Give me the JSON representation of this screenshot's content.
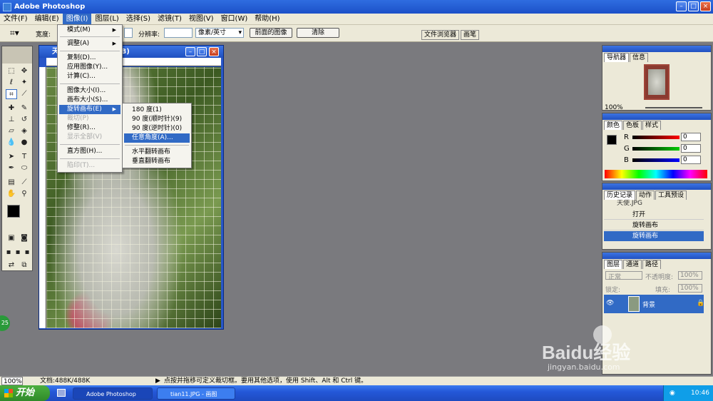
{
  "app": {
    "title": "Adobe Photoshop"
  },
  "menubar": [
    "文件(F)",
    "编辑(E)",
    "图像(I)",
    "图层(L)",
    "选择(S)",
    "滤镜(T)",
    "视图(V)",
    "窗口(W)",
    "帮助(H)"
  ],
  "options": {
    "width_label": "宽度:",
    "resolution_label": "分辨率:",
    "units_value": "像素/英寸",
    "front_image_button": "前面的图像",
    "clear_button": "清除",
    "file_browser_tab": "文件浏览器",
    "brushes_tab": "画笔"
  },
  "document": {
    "title_visible": "天",
    "title_suffix": "(B)"
  },
  "image_menu": {
    "items": [
      {
        "label": "模式(M)",
        "submenu": true
      },
      {
        "label": "调整(A)",
        "submenu": true
      },
      {
        "label": "复制(D)..."
      },
      {
        "label": "应用图像(Y)..."
      },
      {
        "label": "计算(C)..."
      },
      {
        "label": "图像大小(I)..."
      },
      {
        "label": "画布大小(S)..."
      },
      {
        "label": "旋转画布(E)",
        "submenu": true,
        "highlighted": true
      },
      {
        "label": "裁切(P)",
        "disabled": true
      },
      {
        "label": "修整(R)..."
      },
      {
        "label": "显示全部(V)",
        "disabled": true
      },
      {
        "label": "直方图(H)..."
      },
      {
        "label": "陷印(T)...",
        "disabled": true
      }
    ]
  },
  "rotate_submenu": {
    "items": [
      {
        "label": "180 度(1)"
      },
      {
        "label": "90 度(顺时针)(9)"
      },
      {
        "label": "90 度(逆时针)(0)"
      },
      {
        "label": "任意角度(A)...",
        "highlighted": true
      },
      {
        "label": "水平翻转画布"
      },
      {
        "label": "垂直翻转画布"
      }
    ]
  },
  "navigator": {
    "tabs": [
      "导航器",
      "信息"
    ],
    "zoom": "100%"
  },
  "color_palette": {
    "tabs": [
      "颜色",
      "色板",
      "样式"
    ],
    "channels": [
      {
        "label": "R",
        "value": "0"
      },
      {
        "label": "G",
        "value": "0"
      },
      {
        "label": "B",
        "value": "0"
      }
    ]
  },
  "history": {
    "tabs": [
      "历史记录",
      "动作",
      "工具预设"
    ],
    "snapshot": "天使.JPG",
    "items": [
      "打开",
      "旋转画布",
      "旋转画布"
    ]
  },
  "layers": {
    "tabs": [
      "图层",
      "通道",
      "路径"
    ],
    "blend_mode": "正常",
    "opacity_label": "不透明度:",
    "opacity_value": "100%",
    "lock_label": "锁定:",
    "fill_label": "填充:",
    "fill_value": "100%",
    "layer_name": "背景"
  },
  "status": {
    "zoom": "100%",
    "doc_info": "文档:488K/488K",
    "hint": "点按并拖移可定义裁切框。要用其他选项，使用 Shift、Alt 和 Ctrl 键。"
  },
  "taskbar": {
    "start": "开始",
    "tasks": [
      "Adobe Photoshop",
      "tian11.JPG - 画图"
    ],
    "clock": "10:46"
  },
  "badge": {
    "number": "25"
  },
  "watermark": {
    "brand": "Baidu经验",
    "url": "jingyan.baidu.com"
  },
  "colors": {
    "titlebar": "#2050c0",
    "menu_highlight": "#316ac5",
    "workspace": "#7a7a7e",
    "taskbar": "#2458d8",
    "start": "#2f8a2a"
  }
}
